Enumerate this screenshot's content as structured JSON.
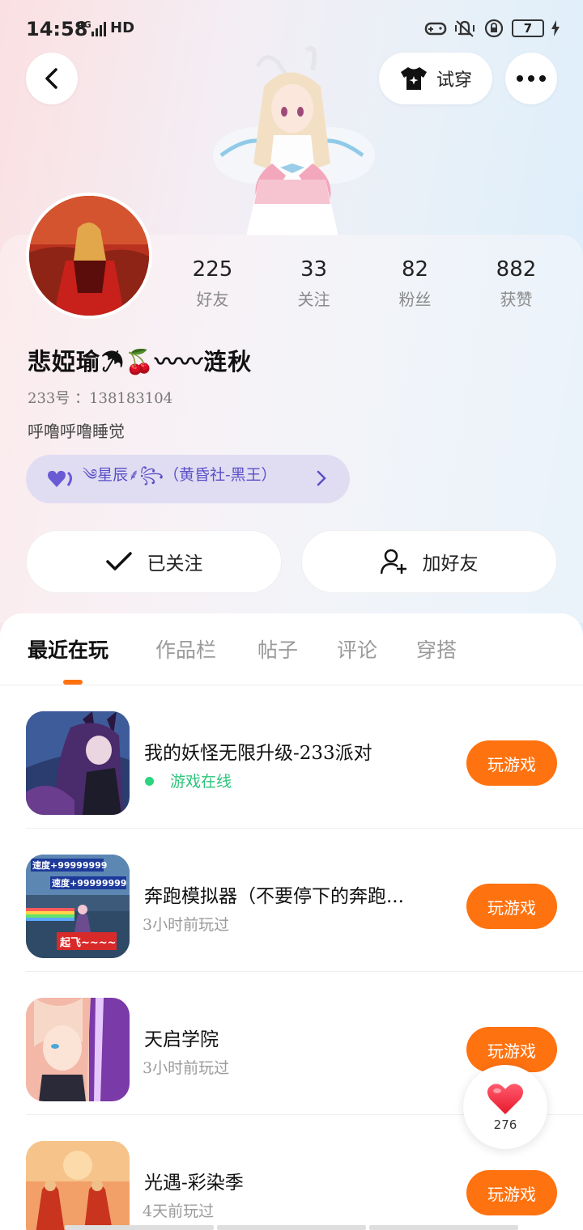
{
  "status_bar": {
    "time": "14:58",
    "network": "4G",
    "hd": "HD",
    "battery": "7"
  },
  "header": {
    "try_on_label": "试穿"
  },
  "profile": {
    "stats": [
      {
        "value": "225",
        "label": "好友"
      },
      {
        "value": "33",
        "label": "关注"
      },
      {
        "value": "82",
        "label": "粉丝"
      },
      {
        "value": "882",
        "label": "获赞"
      }
    ],
    "nickname": "悲婭瑜☂🍒〰〰涟秋",
    "user_id": "233号 ：138183104",
    "bio": "呼噜呼噜睡觉",
    "family_tag": "༄星辰⸙꧂（黄昏社-黑王）"
  },
  "actions": {
    "follow_label": "已关注",
    "add_friend_label": "加好友"
  },
  "tabs": [
    {
      "label": "最近在玩",
      "active": true
    },
    {
      "label": "作品栏",
      "active": false
    },
    {
      "label": "帖子",
      "active": false
    },
    {
      "label": "评论",
      "active": false
    },
    {
      "label": "穿搭",
      "active": false
    }
  ],
  "games": [
    {
      "name": "我的妖怪无限升级-233派对",
      "status": "游戏在线",
      "online": true,
      "play_label": "玩游戏"
    },
    {
      "name": "奔跑模拟器（不要停下的奔跑...",
      "status": "3小时前玩过",
      "online": false,
      "play_label": "玩游戏",
      "thumb_texts": [
        "速度+99999999",
        "速度+99999999",
        "起飞~~~~"
      ]
    },
    {
      "name": "天启学院",
      "status": "3小时前玩过",
      "online": false,
      "play_label": "玩游戏"
    },
    {
      "name": "光遇-彩染季",
      "status": "4天前玩过",
      "online": false,
      "play_label": "玩游戏"
    }
  ],
  "like_fab": {
    "count": "276"
  },
  "colors": {
    "accent": "#ff7210",
    "online": "#2bc47a",
    "family_pill": "#e0ddf3",
    "family_text": "#5b4fc6"
  }
}
